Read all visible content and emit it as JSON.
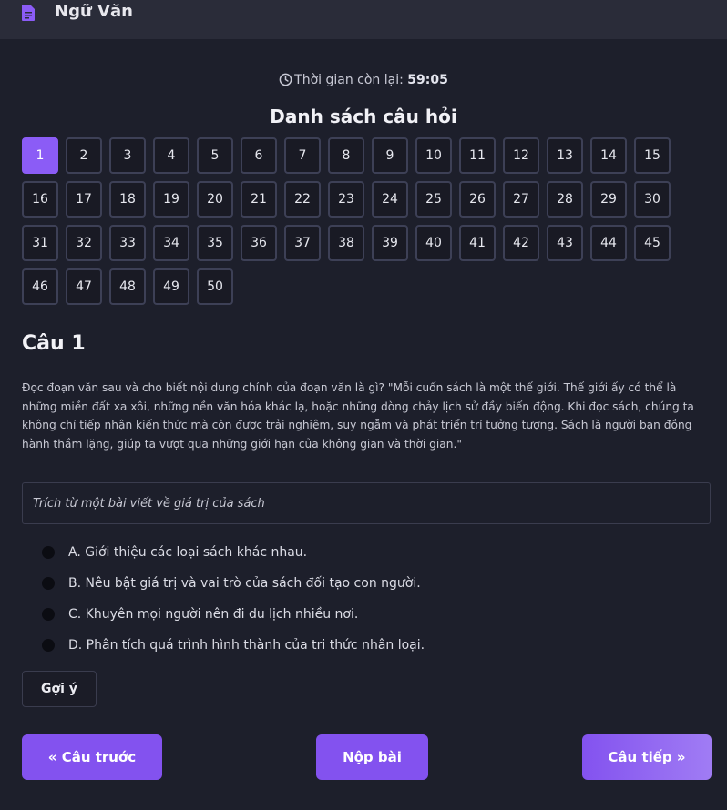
{
  "header": {
    "subject": "Ngữ Văn",
    "icon": "document-icon"
  },
  "timer": {
    "label": "Thời gian còn lại:",
    "value": "59:05",
    "icon": "clock-icon"
  },
  "question_list": {
    "title": "Danh sách câu hỏi",
    "numbers": [
      "1",
      "2",
      "3",
      "4",
      "5",
      "6",
      "7",
      "8",
      "9",
      "10",
      "11",
      "12",
      "13",
      "14",
      "15",
      "16",
      "17",
      "18",
      "19",
      "20",
      "21",
      "22",
      "23",
      "24",
      "25",
      "26",
      "27",
      "28",
      "29",
      "30",
      "31",
      "32",
      "33",
      "34",
      "35",
      "36",
      "37",
      "38",
      "39",
      "40",
      "41",
      "42",
      "43",
      "44",
      "45",
      "46",
      "47",
      "48",
      "49",
      "50"
    ],
    "active": "1",
    "active_color": "#8b5cf6"
  },
  "question": {
    "heading": "Câu 1",
    "text": "Đọc đoạn văn sau và cho biết nội dung chính của đoạn văn là gì? \"Mỗi cuốn sách là một thế giới. Thế giới ấy có thể là những miền đất xa xôi, những nền văn hóa khác lạ, hoặc những dòng chảy lịch sử đầy biến động. Khi đọc sách, chúng ta không chỉ tiếp nhận kiến thức mà còn được trải nghiệm, suy ngẫm và phát triển trí tưởng tượng. Sách là người bạn đồng hành thầm lặng, giúp ta vượt qua những giới hạn của không gian và thời gian.\"",
    "source": "Trích từ một bài viết về giá trị của sách",
    "options": [
      "A. Giới thiệu các loại sách khác nhau.",
      "B. Nêu bật giá trị và vai trò của sách đối tạo con người.",
      "C. Khuyên mọi người nên đi du lịch nhiều nơi.",
      "D. Phân tích quá trình hình thành của tri thức nhân loại."
    ]
  },
  "buttons": {
    "hint": "Gợi ý",
    "prev": "« Câu trước",
    "submit": "Nộp bài",
    "next": "Câu tiếp »"
  },
  "colors": {
    "accent": "#8352ef",
    "background": "#1d1f2b",
    "topbar": "#2a2c39"
  }
}
